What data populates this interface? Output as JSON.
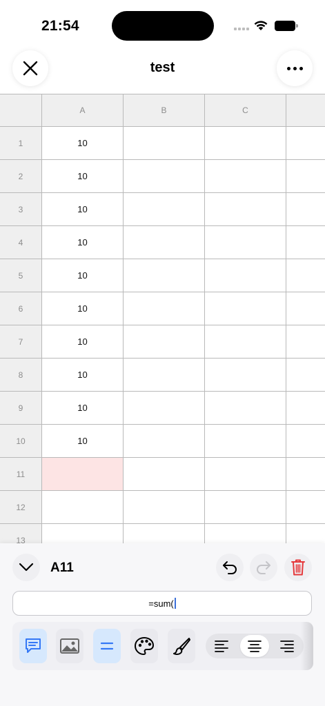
{
  "status_bar": {
    "time": "21:54"
  },
  "nav": {
    "title": "test"
  },
  "sheet": {
    "columns": [
      "A",
      "B",
      "C"
    ],
    "rows": [
      {
        "label": "1",
        "cells": [
          "10",
          "",
          "",
          ""
        ]
      },
      {
        "label": "2",
        "cells": [
          "10",
          "",
          "",
          ""
        ]
      },
      {
        "label": "3",
        "cells": [
          "10",
          "",
          "",
          ""
        ]
      },
      {
        "label": "4",
        "cells": [
          "10",
          "",
          "",
          ""
        ]
      },
      {
        "label": "5",
        "cells": [
          "10",
          "",
          "",
          ""
        ]
      },
      {
        "label": "6",
        "cells": [
          "10",
          "",
          "",
          ""
        ]
      },
      {
        "label": "7",
        "cells": [
          "10",
          "",
          "",
          ""
        ]
      },
      {
        "label": "8",
        "cells": [
          "10",
          "",
          "",
          ""
        ]
      },
      {
        "label": "9",
        "cells": [
          "10",
          "",
          "",
          ""
        ]
      },
      {
        "label": "10",
        "cells": [
          "10",
          "",
          "",
          ""
        ]
      },
      {
        "label": "11",
        "cells": [
          "",
          "",
          "",
          ""
        ]
      },
      {
        "label": "12",
        "cells": [
          "",
          "",
          "",
          ""
        ]
      },
      {
        "label": "13",
        "cells": [
          "",
          "",
          "",
          ""
        ]
      }
    ],
    "selected_cell": "A11",
    "selected_color": "#fde4e4"
  },
  "editor": {
    "cell_reference": "A11",
    "formula": "=sum(",
    "accent": "#3478f6",
    "delete_color": "#e5383b",
    "tools": [
      {
        "icon": "comment-icon",
        "active": true
      },
      {
        "icon": "image-icon",
        "active": false
      },
      {
        "icon": "equals-icon",
        "active": true
      },
      {
        "icon": "palette-icon",
        "active": false
      },
      {
        "icon": "brush-icon",
        "active": false
      }
    ],
    "alignment": {
      "options": [
        "left-align-icon",
        "center-align-icon",
        "right-align-icon"
      ],
      "selected": "center"
    }
  }
}
